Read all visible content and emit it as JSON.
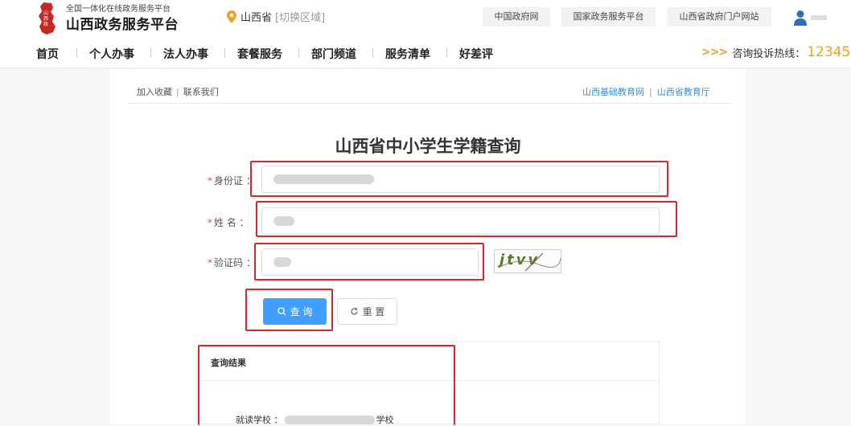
{
  "header": {
    "subtitle": "全国一体化在线政务服务平台",
    "title": "山西政务服务平台",
    "location": "山西省",
    "location_switch": "[切换区域]",
    "links": [
      "中国政府网",
      "国家政务服务平台",
      "山西省政府门户网站"
    ]
  },
  "nav": {
    "items": [
      "首页",
      "个人办事",
      "法人办事",
      "套餐服务",
      "部门频道",
      "服务清单",
      "好差评"
    ],
    "hotline_arrows": ">>>",
    "hotline_label": "咨询投诉热线：",
    "hotline_number": "12345"
  },
  "page": {
    "crumbs": [
      "加入收藏",
      "联系我们"
    ],
    "related_sites": [
      "山西基础教育网",
      "山西省教育厅"
    ],
    "title": "山西省中小学生学籍查询"
  },
  "form": {
    "required_mark": "*",
    "id_label": "身份证 ：",
    "name_label": "姓    名 ：",
    "captcha_label": "验证码 ：",
    "captcha_text": "jtvv",
    "query_button": "查 询",
    "reset_button": "重 置"
  },
  "result": {
    "title": "查询结果",
    "school_label": "就读学校 ：",
    "school_suffix": "学校"
  },
  "colors": {
    "primary": "#409eff",
    "highlight_box": "#d42a2a",
    "hotline": "#f0a020",
    "link": "#3a8fd6"
  }
}
